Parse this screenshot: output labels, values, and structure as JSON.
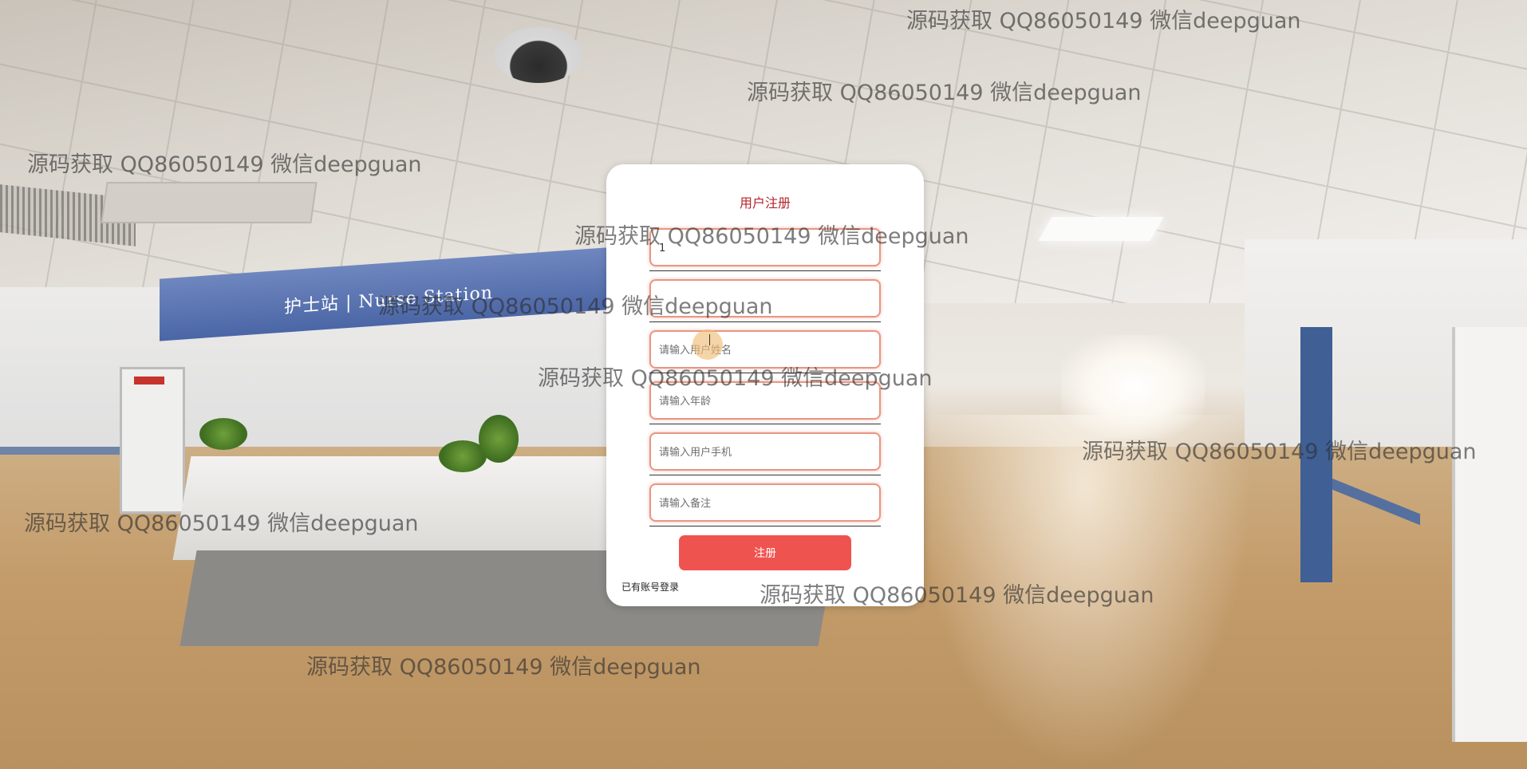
{
  "background": {
    "sign_text": "护士站 | Nurse Station"
  },
  "watermark": "源码获取 QQ86050149 微信deepguan",
  "register": {
    "title": "用户注册",
    "fields": [
      {
        "placeholder": "",
        "value": "1"
      },
      {
        "placeholder": "",
        "value": ""
      },
      {
        "placeholder": "请输入用户姓名",
        "value": ""
      },
      {
        "placeholder": "请输入年龄",
        "value": ""
      },
      {
        "placeholder": "请输入用户手机",
        "value": ""
      },
      {
        "placeholder": "请输入备注",
        "value": ""
      }
    ],
    "submit_label": "注册",
    "login_link": "已有账号登录"
  },
  "colors": {
    "title": "#b3262b",
    "button": "#ef5350",
    "field_border": "#e99682"
  }
}
